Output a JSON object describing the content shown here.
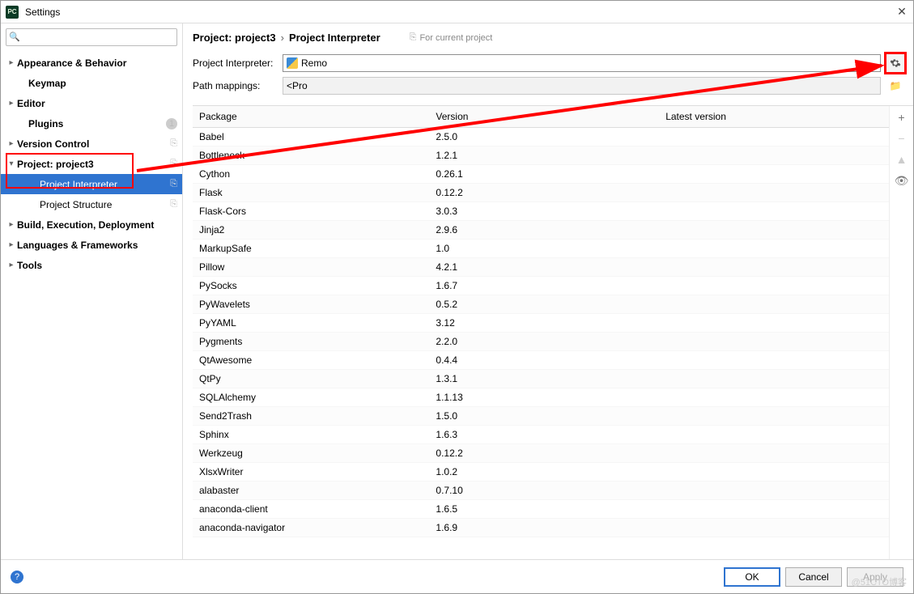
{
  "window": {
    "title": "Settings",
    "app_icon_text": "PC",
    "close_glyph": "✕"
  },
  "search": {
    "placeholder": "",
    "icon": "🔍"
  },
  "sidebar": {
    "items": [
      {
        "label": "Appearance & Behavior",
        "depth": 0,
        "bold": true,
        "arrow": "right",
        "trail": ""
      },
      {
        "label": "Keymap",
        "depth": 1,
        "bold": true,
        "arrow": "",
        "trail": ""
      },
      {
        "label": "Editor",
        "depth": 0,
        "bold": true,
        "arrow": "right",
        "trail": ""
      },
      {
        "label": "Plugins",
        "depth": 1,
        "bold": true,
        "arrow": "",
        "trail": "badge",
        "badge": "1"
      },
      {
        "label": "Version Control",
        "depth": 0,
        "bold": true,
        "arrow": "right",
        "trail": "copy"
      },
      {
        "label": "Project: project3",
        "depth": 0,
        "bold": true,
        "arrow": "down",
        "trail": "copy",
        "annot_box": true
      },
      {
        "label": "Project Interpreter",
        "depth": 2,
        "bold": false,
        "arrow": "",
        "trail": "copy",
        "selected": true
      },
      {
        "label": "Project Structure",
        "depth": 2,
        "bold": false,
        "arrow": "",
        "trail": "copy"
      },
      {
        "label": "Build, Execution, Deployment",
        "depth": 0,
        "bold": true,
        "arrow": "right",
        "trail": ""
      },
      {
        "label": "Languages & Frameworks",
        "depth": 0,
        "bold": true,
        "arrow": "right",
        "trail": ""
      },
      {
        "label": "Tools",
        "depth": 0,
        "bold": true,
        "arrow": "right",
        "trail": ""
      }
    ]
  },
  "breadcrumb": {
    "a": "Project: project3",
    "b": "Project Interpreter",
    "hint": "For current project"
  },
  "form": {
    "interpreter_label": "Project Interpreter:",
    "interpreter_value": "Remo",
    "mappings_label": "Path mappings:",
    "mappings_value": "<Pro"
  },
  "table": {
    "headers": {
      "package": "Package",
      "version": "Version",
      "latest": "Latest version"
    },
    "rows": [
      {
        "p": "Babel",
        "v": "2.5.0",
        "l": ""
      },
      {
        "p": "Bottleneck",
        "v": "1.2.1",
        "l": ""
      },
      {
        "p": "Cython",
        "v": "0.26.1",
        "l": ""
      },
      {
        "p": "Flask",
        "v": "0.12.2",
        "l": ""
      },
      {
        "p": "Flask-Cors",
        "v": "3.0.3",
        "l": ""
      },
      {
        "p": "Jinja2",
        "v": "2.9.6",
        "l": ""
      },
      {
        "p": "MarkupSafe",
        "v": "1.0",
        "l": ""
      },
      {
        "p": "Pillow",
        "v": "4.2.1",
        "l": ""
      },
      {
        "p": "PySocks",
        "v": "1.6.7",
        "l": ""
      },
      {
        "p": "PyWavelets",
        "v": "0.5.2",
        "l": ""
      },
      {
        "p": "PyYAML",
        "v": "3.12",
        "l": ""
      },
      {
        "p": "Pygments",
        "v": "2.2.0",
        "l": ""
      },
      {
        "p": "QtAwesome",
        "v": "0.4.4",
        "l": ""
      },
      {
        "p": "QtPy",
        "v": "1.3.1",
        "l": ""
      },
      {
        "p": "SQLAlchemy",
        "v": "1.1.13",
        "l": ""
      },
      {
        "p": "Send2Trash",
        "v": "1.5.0",
        "l": ""
      },
      {
        "p": "Sphinx",
        "v": "1.6.3",
        "l": ""
      },
      {
        "p": "Werkzeug",
        "v": "0.12.2",
        "l": ""
      },
      {
        "p": "XlsxWriter",
        "v": "1.0.2",
        "l": ""
      },
      {
        "p": "alabaster",
        "v": "0.7.10",
        "l": ""
      },
      {
        "p": "anaconda-client",
        "v": "1.6.5",
        "l": ""
      },
      {
        "p": "anaconda-navigator",
        "v": "1.6.9",
        "l": ""
      }
    ]
  },
  "side_actions": {
    "add": "+",
    "remove": "−",
    "up": "▲",
    "eye": "👁"
  },
  "footer": {
    "ok": "OK",
    "cancel": "Cancel",
    "apply": "Apply",
    "help": "?"
  },
  "watermark": "@51CTO博客"
}
